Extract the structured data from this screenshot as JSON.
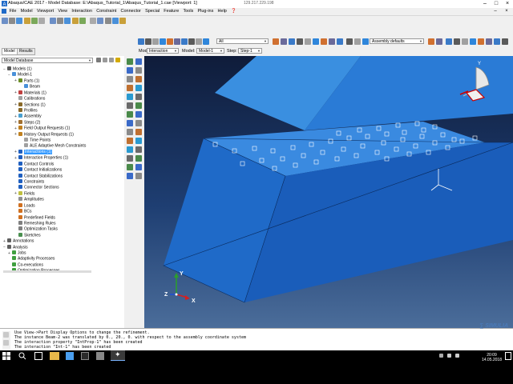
{
  "window": {
    "title": "Abaqus/CAE 2017 - Model Database: E:\\Abaqus_Tutorial_1\\Abaqus_Tutorial_1.cae [Viewport: 1]",
    "remote_ip": "129.217.229.198"
  },
  "menu": [
    "File",
    "Model",
    "Viewport",
    "View",
    "Interaction",
    "Constraint",
    "Connector",
    "Special",
    "Feature",
    "Tools",
    "Plug-ins",
    "Help",
    "❓"
  ],
  "toolbar": {
    "all_label": "All",
    "assembly_combo": "Assembly defaults"
  },
  "context": {
    "module_label": "Module:",
    "module_value": "Interaction",
    "model_label": "Model:",
    "model_value": "Model-1",
    "step_label": "Step:",
    "step_value": "Step-1"
  },
  "tabs": [
    "Model",
    "Results"
  ],
  "tree": {
    "combo": "Model Database",
    "rows": [
      {
        "label": "Models (1)"
      },
      {
        "label": "Model-1"
      },
      {
        "label": "Parts (1)"
      },
      {
        "label": "Beam"
      },
      {
        "label": "Materials (1)"
      },
      {
        "label": "Calibrations"
      },
      {
        "label": "Sections (1)"
      },
      {
        "label": "Profiles"
      },
      {
        "label": "Assembly"
      },
      {
        "label": "Steps (2)"
      },
      {
        "label": "Field Output Requests (1)"
      },
      {
        "label": "History Output Requests (1)"
      },
      {
        "label": "Time Points"
      },
      {
        "label": "ALE Adaptive Mesh Constraints"
      },
      {
        "label": "Interactions (1)"
      },
      {
        "label": "Interaction Properties (1)"
      },
      {
        "label": "Contact Controls"
      },
      {
        "label": "Contact Initializations"
      },
      {
        "label": "Contact Stabilizations"
      },
      {
        "label": "Constraints"
      },
      {
        "label": "Connector Sections"
      },
      {
        "label": "Fields"
      },
      {
        "label": "Amplitudes"
      },
      {
        "label": "Loads"
      },
      {
        "label": "BCs"
      },
      {
        "label": "Predefined Fields"
      },
      {
        "label": "Remeshing Rules"
      },
      {
        "label": "Optimization Tasks"
      },
      {
        "label": "Sketches"
      },
      {
        "label": "Annotations"
      },
      {
        "label": "Analysis"
      },
      {
        "label": "Jobs"
      },
      {
        "label": "Adaptivity Processes"
      },
      {
        "label": "Co-executions"
      },
      {
        "label": "Optimization Processes"
      }
    ]
  },
  "triad": {
    "x": "X",
    "y": "Y",
    "z": "Z"
  },
  "messages": [
    "Use View->Part Display Options to change the refinement.",
    "The instance Beam-2 was translated by 0., 20., 0. with respect to the assembly coordinate system",
    "The interaction property \"IntProp-1\" has been created",
    "The interaction \"Int-1\" has been created"
  ],
  "brand": "SIMULIA",
  "clock": {
    "time": "20:09",
    "date": "14.05.2018"
  },
  "colors": {
    "part_top": "#2f86db",
    "part_front": "#1f6ac8",
    "part_side": "#1552a8",
    "highlight": "#3399ff"
  }
}
